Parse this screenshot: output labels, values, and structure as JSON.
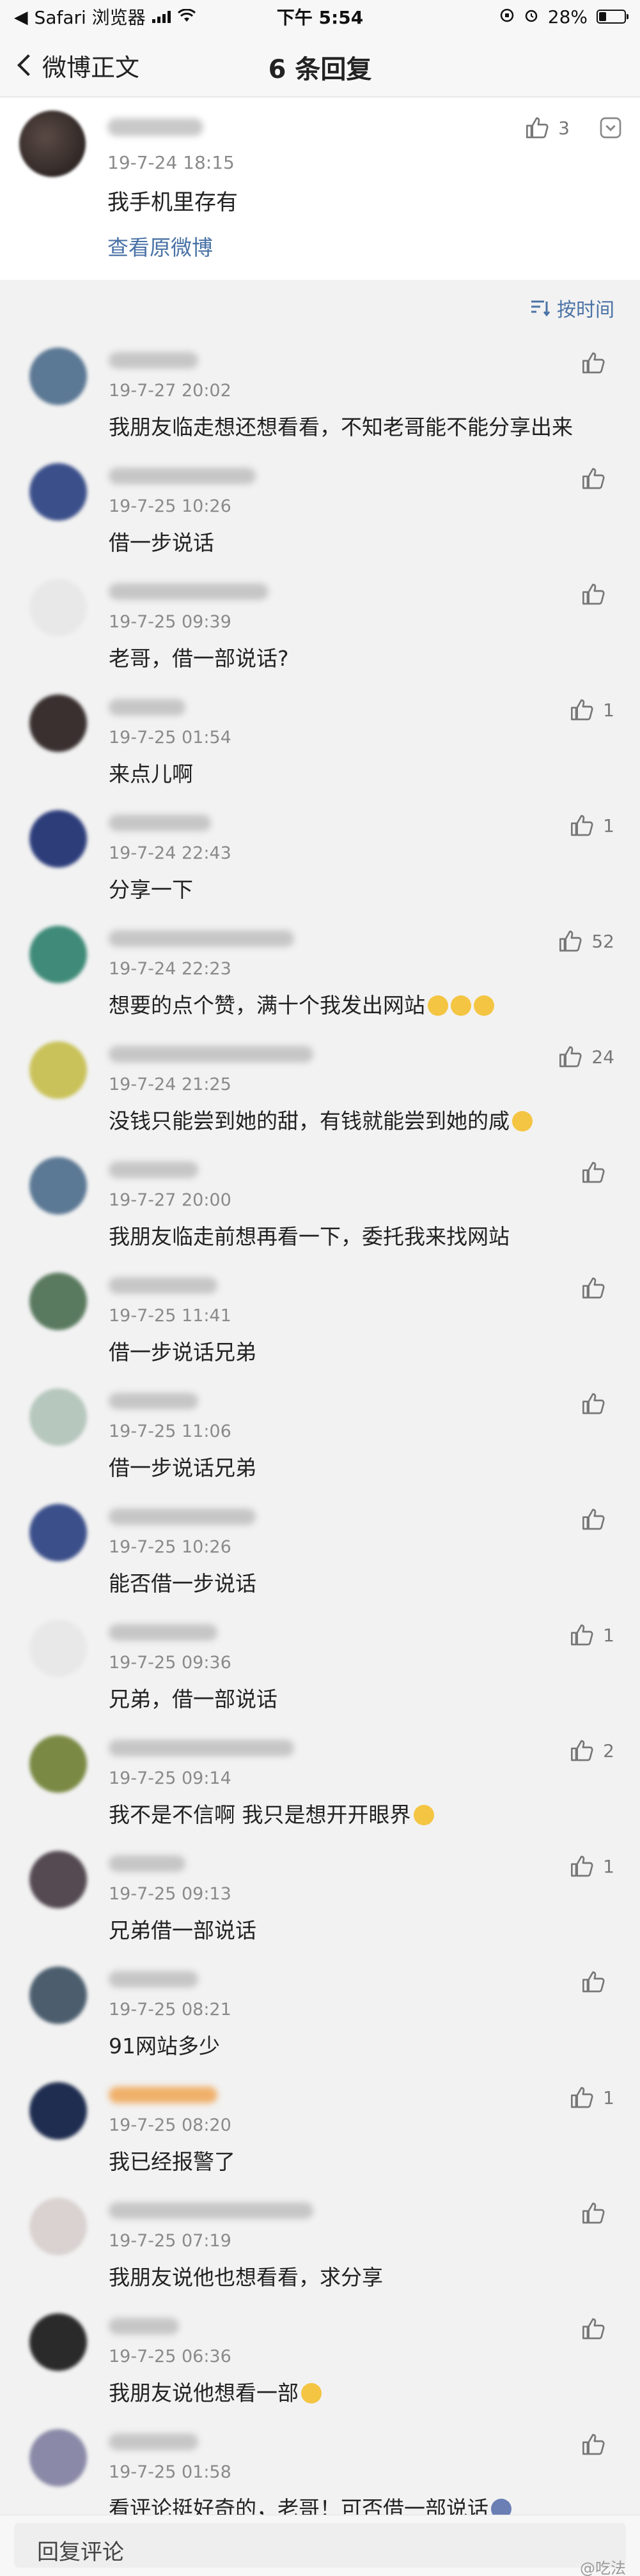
{
  "status_bar": {
    "carrier": "Safari 浏览器",
    "time": "下午 5:54",
    "battery": "28%",
    "battery_level": 0.28
  },
  "nav": {
    "back_label": "微博正文",
    "title": "6 条回复"
  },
  "root_post": {
    "time": "19-7-24 18:15",
    "text": "我手机里存有",
    "like_count": "3",
    "view_original": "查看原微博"
  },
  "sort": {
    "label": "按时间"
  },
  "replies": [
    {
      "time": "19-7-27 20:02",
      "text": "我朋友临走想还想看看，不知老哥能不能分享出来",
      "likes": ""
    },
    {
      "time": "19-7-25 10:26",
      "text": "借一步说话",
      "likes": ""
    },
    {
      "time": "19-7-25 09:39",
      "text": "老哥，借一部说话?",
      "likes": ""
    },
    {
      "time": "19-7-25 01:54",
      "text": "来点儿啊",
      "likes": "1"
    },
    {
      "time": "19-7-24 22:43",
      "text": "分享一下",
      "likes": "1"
    },
    {
      "time": "19-7-24 22:23",
      "text": "想要的点个赞，满十个我发出网站",
      "likes": "52"
    },
    {
      "time": "19-7-24 21:25",
      "text": "没钱只能尝到她的甜，有钱就能尝到她的咸",
      "likes": "24"
    },
    {
      "time": "19-7-27 20:00",
      "text": "我朋友临走前想再看一下，委托我来找网站",
      "likes": ""
    },
    {
      "time": "19-7-25 11:41",
      "text": "借一步说话兄弟",
      "likes": ""
    },
    {
      "time": "19-7-25 11:06",
      "text": "借一步说话兄弟",
      "likes": ""
    },
    {
      "time": "19-7-25 10:26",
      "text": "能否借一步说话",
      "likes": ""
    },
    {
      "time": "19-7-25 09:36",
      "text": "兄弟，借一部说话",
      "likes": "1"
    },
    {
      "time": "19-7-25 09:14",
      "text": "我不是不信啊 我只是想开开眼界",
      "likes": "2"
    },
    {
      "time": "19-7-25 09:13",
      "text": "兄弟借一部说话",
      "likes": "1"
    },
    {
      "time": "19-7-25 08:21",
      "text": "91网站多少",
      "likes": ""
    },
    {
      "time": "19-7-25 08:20",
      "text": "我已经报警了",
      "likes": "1"
    },
    {
      "time": "19-7-25 07:19",
      "text": "我朋友说他也想看看，求分享",
      "likes": ""
    },
    {
      "time": "19-7-25 06:36",
      "text": "我朋友说他想看一部",
      "likes": ""
    },
    {
      "time": "19-7-25 01:58",
      "text": "看评论挺好奇的，老哥！可否借一部说话",
      "likes": ""
    }
  ],
  "comment_bar": {
    "placeholder": "回复评论"
  },
  "watermark": "@吃法"
}
